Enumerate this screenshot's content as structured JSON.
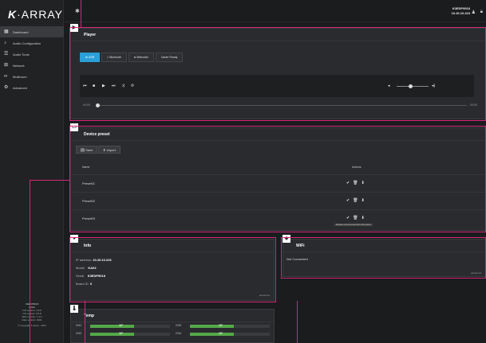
{
  "brand": {
    "logo_k": "K",
    "logo_rest": "·ARRAY"
  },
  "sidebar": {
    "items": [
      {
        "label": "Dashboard",
        "icon": "dashboard-icon",
        "glyph": "▦"
      },
      {
        "label": "Audio Configuration",
        "icon": "music-note-icon",
        "glyph": "♪"
      },
      {
        "label": "Audio Tools",
        "icon": "sliders-icon",
        "glyph": "☰"
      },
      {
        "label": "Network",
        "icon": "network-icon",
        "glyph": "⊞"
      },
      {
        "label": "Multiroom",
        "icon": "link-icon",
        "glyph": "∞"
      },
      {
        "label": "Advanced",
        "icon": "gear-icon",
        "glyph": "⚙"
      }
    ],
    "footer": {
      "device": "K3EDP9018",
      "model": "KA02",
      "fw_lines": [
        "FW version: 1.8.0",
        "OS version: 2.0.8",
        "Web version: 1.4.0",
        "Date version: 2021"
      ],
      "copyright": "© Copyright K-array - 2021"
    }
  },
  "topbar": {
    "device_name": "K3EDP9018",
    "ip": "10.20.10.223"
  },
  "player": {
    "title": "Player",
    "tabs": [
      "USB",
      "Bluetooth",
      "Webradio",
      "Dante Ready"
    ],
    "active_tab": "USB",
    "time_start": "00:00",
    "time_end": "00:00"
  },
  "preset": {
    "title": "Device preset",
    "save_label": "Save",
    "import_label": "Import",
    "col_name": "Name",
    "col_actions": "Actions",
    "rows": [
      "Preset01",
      "Preset02",
      "Preset03"
    ],
    "tooltip": "Rename current preset from this preset"
  },
  "info": {
    "title": "Info",
    "ip_label": "IP address:",
    "ip": "10.20.10.223",
    "model_label": "Model",
    "model": "KA02",
    "serial_label": "Serial",
    "serial": "K3EDP9018",
    "board_label": "Board ID",
    "board": "0",
    "more": "advanced"
  },
  "wifi": {
    "title": "WiFi",
    "status": "Not Connected",
    "more": "advanced"
  },
  "temp": {
    "title": "Temp",
    "channels": [
      {
        "name": "CH1",
        "value": "38°",
        "level": 0.55
      },
      {
        "name": "CH2",
        "value": "38°",
        "level": 0.55
      },
      {
        "name": "CH3",
        "value": "38°",
        "level": 0.55
      },
      {
        "name": "CH4",
        "value": "38°",
        "level": 0.55
      }
    ]
  },
  "colors": {
    "accent": "#2a9fd8",
    "highlight": "#d4277b",
    "ok": "#55a84a"
  }
}
